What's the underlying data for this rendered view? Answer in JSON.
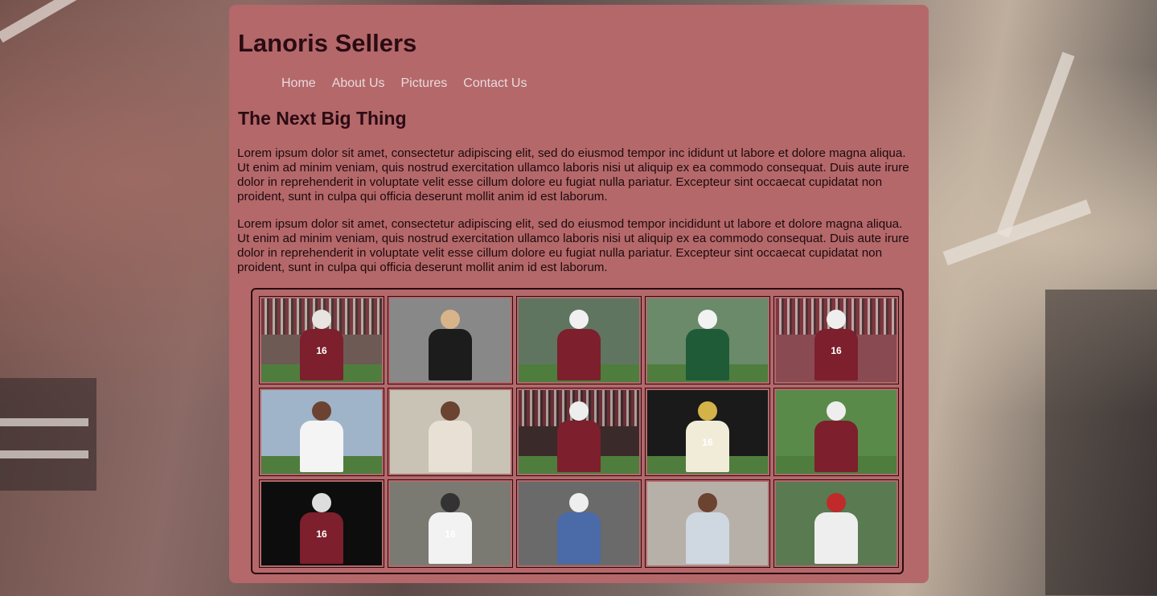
{
  "site": {
    "title": "Lanoris Sellers"
  },
  "nav": {
    "items": [
      {
        "label": "Home"
      },
      {
        "label": "About Us"
      },
      {
        "label": "Pictures"
      },
      {
        "label": "Contact Us"
      }
    ]
  },
  "main": {
    "heading": "The Next Big Thing",
    "paragraphs": [
      "Lorem ipsum dolor sit amet, consectetur adipiscing elit, sed do eiusmod tempor inc ididunt ut labore et dolore magna aliqua. Ut enim ad minim veniam, quis nostrud exercitation ullamco laboris nisi ut aliquip ex ea commodo consequat. Duis aute irure dolor in reprehenderit in voluptate velit esse cillum dolore eu fugiat nulla pariatur. Excepteur sint occaecat cupidatat non proident, sunt in culpa qui officia deserunt mollit anim id est laborum.",
      "Lorem ipsum dolor sit amet, consectetur adipiscing elit, sed do eiusmod tempor incididunt ut labore et dolore magna aliqua. Ut enim ad minim veniam, quis nostrud exercitation ullamco laboris nisi ut aliquip ex ea commodo consequat. Duis aute irure dolor in reprehenderit in voluptate velit esse cillum dolore eu fugiat nulla pariatur. Excepteur sint occaecat cupidatat non proident, sunt in culpa qui officia deserunt mollit anim id est laborum."
    ]
  },
  "colors": {
    "panel": "#b4686a",
    "title": "#2a0b12",
    "nav_link": "#ead9dc",
    "garnet": "#7d1f2c"
  },
  "gallery": {
    "photos": [
      {
        "name": "photo-qb-dropback",
        "jersey": "16"
      },
      {
        "name": "photo-portrait-suit",
        "jersey": ""
      },
      {
        "name": "photo-carolina-qb-ball",
        "jersey": ""
      },
      {
        "name": "photo-carolina-green-jersey",
        "jersey": ""
      },
      {
        "name": "photo-qb-throwing-crowd",
        "jersey": "16"
      },
      {
        "name": "photo-rivals-camp-throw",
        "jersey": ""
      },
      {
        "name": "photo-podium-signing",
        "jersey": ""
      },
      {
        "name": "photo-espn-run",
        "jersey": ""
      },
      {
        "name": "photo-white-jersey-back",
        "jersey": "16"
      },
      {
        "name": "photo-goal-line-dive",
        "jersey": ""
      },
      {
        "name": "photo-studio-pose",
        "jersey": "16"
      },
      {
        "name": "photo-sideline-white-jersey",
        "jersey": "16"
      },
      {
        "name": "photo-blue-jersey-throw",
        "jersey": ""
      },
      {
        "name": "photo-hospital-bed",
        "jersey": ""
      },
      {
        "name": "photo-sideline-teammates",
        "jersey": ""
      }
    ]
  }
}
